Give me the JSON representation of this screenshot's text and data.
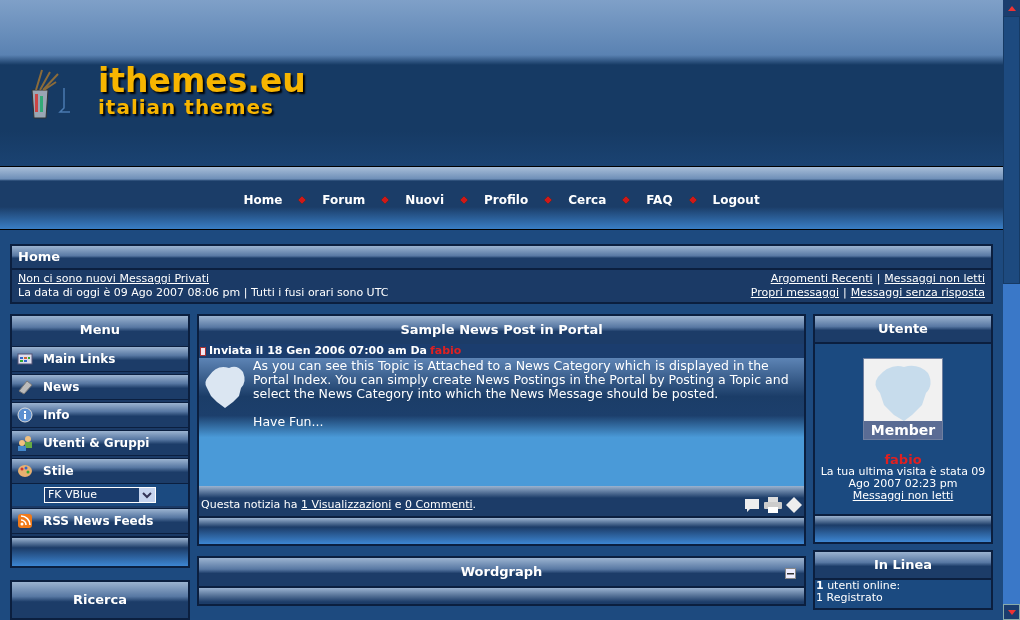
{
  "header": {
    "logo_title": "ithemes.eu",
    "logo_subtitle": "italian themes"
  },
  "nav": [
    {
      "label": "Home"
    },
    {
      "label": "Forum"
    },
    {
      "label": "Nuovi"
    },
    {
      "label": "Profilo"
    },
    {
      "label": "Cerca"
    },
    {
      "label": "FAQ"
    },
    {
      "label": "Logout"
    }
  ],
  "home_panel": {
    "title": "Home",
    "pm_link": "Non ci sono nuovi Messaggi Privati",
    "date_text": "La data di oggi è 09 Ago 2007 08:06 pm | Tutti i fusi orari sono UTC",
    "right_rows": [
      [
        "Argomenti Recenti",
        "|",
        "Messaggi non letti"
      ],
      [
        "Propri messaggi",
        "|",
        "Messaggi senza risposta"
      ]
    ]
  },
  "menu": {
    "title": "Menu",
    "items": [
      {
        "label": "Main Links"
      },
      {
        "label": "News"
      },
      {
        "label": "Info"
      },
      {
        "label": "Utenti & Gruppi"
      },
      {
        "label": "Stile"
      },
      {
        "label": "RSS News Feeds"
      }
    ],
    "style_select": {
      "value": "FK VBlue"
    }
  },
  "search_panel": {
    "title": "Ricerca"
  },
  "news": {
    "title": "Sample News Post in Portal",
    "meta": "Inviata il  18 Gen 2006 07:00 am Da",
    "author": "fabio",
    "body": "As you can see this Topic is Attached to a News Category which is displayed in the Portal Index. You can simply create News Postings in the Portal by Posting a Topic and select the News Category into which the News Message should be posted.",
    "closing": "Have Fun...",
    "stats_prefix": "Questa notizia ha",
    "views_link": "1 Visualizzazioni",
    "stats_middle": "e",
    "comments_link": "0 Commenti",
    "stats_suffix": "."
  },
  "wordgraph": {
    "title": "Wordgraph"
  },
  "user_panel": {
    "title": "Utente",
    "rank": "Member",
    "username": "fabio",
    "last_visit": "La tua ultima visita è stata 09 Ago 2007 02:23 pm",
    "unread_link": "Messaggi non letti"
  },
  "online_panel": {
    "title": "In Linea",
    "lines": [
      "**1** utenti online:",
      "1 Registrato"
    ]
  }
}
